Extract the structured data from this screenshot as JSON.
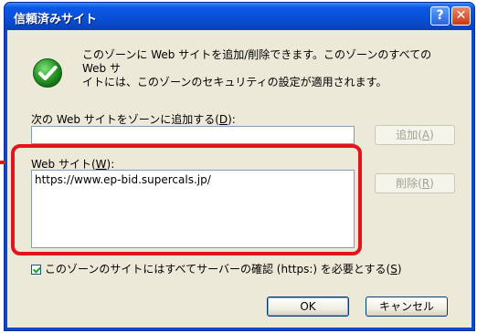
{
  "window": {
    "title": "信頼済みサイト",
    "help_label": "?",
    "close_label": "✕"
  },
  "info": {
    "icon": "check-icon",
    "text": "このゾーンに Web サイトを追加/削除できます。このゾーンのすべての Web サ\nイトには、このゾーンのセキュリティの設定が適用されます。"
  },
  "add_site": {
    "label_prefix": "次の Web サイトをゾーンに追加する(",
    "label_accel": "D",
    "label_suffix": "):",
    "value": "",
    "button_prefix": "追加(",
    "button_accel": "A",
    "button_suffix": ")"
  },
  "sites": {
    "label_prefix": "Web サイト(",
    "label_accel": "W",
    "label_suffix": "):",
    "items": [
      "https://www.ep-bid.supercals.jp/"
    ],
    "remove_prefix": "削除(",
    "remove_accel": "R",
    "remove_suffix": ")"
  },
  "require_https": {
    "checked": true,
    "label_prefix": "このゾーンのサイトにはすべてサーバーの確認 (https:) を必要とする(",
    "label_accel": "S",
    "label_suffix": ")"
  },
  "buttons": {
    "ok": "OK",
    "cancel": "キャンセル"
  },
  "annotation": {
    "color": "#e3141c"
  }
}
